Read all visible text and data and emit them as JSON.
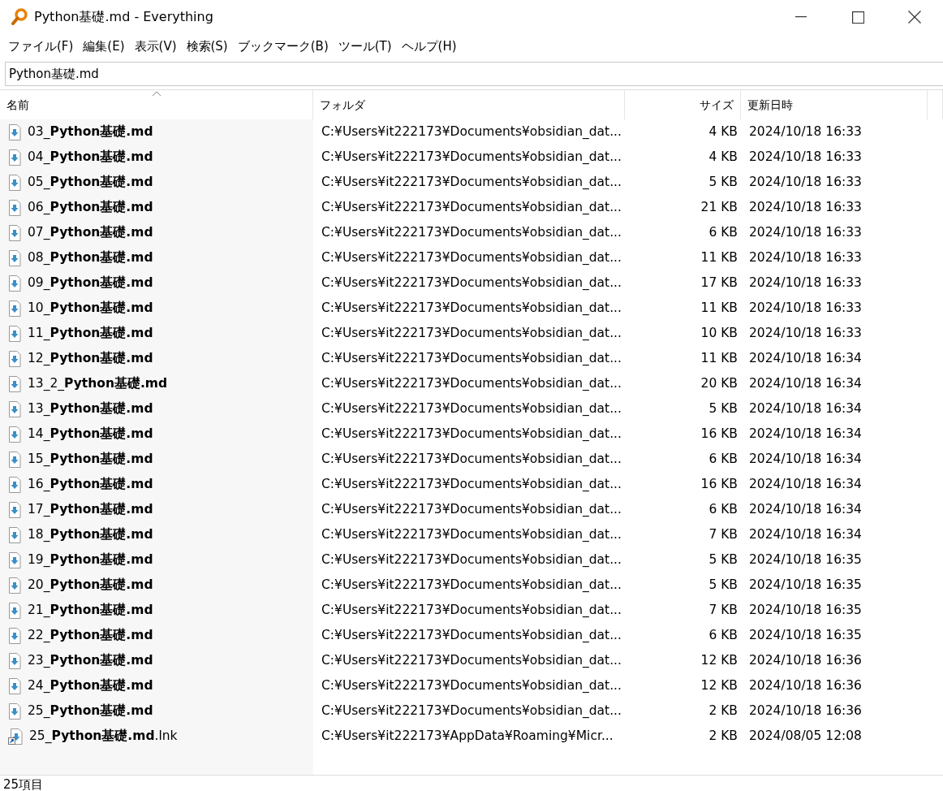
{
  "window": {
    "title": "Python基礎.md - Everything"
  },
  "menu": [
    "ファイル(F)",
    "編集(E)",
    "表示(V)",
    "検索(S)",
    "ブックマーク(B)",
    "ツール(T)",
    "ヘルプ(H)"
  ],
  "search": {
    "value": "Python基礎.md"
  },
  "columns": [
    {
      "label": "名前",
      "sorted": true
    },
    {
      "label": "フォルダ",
      "sorted": false
    },
    {
      "label": "サイズ",
      "sorted": false
    },
    {
      "label": "更新日時",
      "sorted": false
    }
  ],
  "rows": [
    {
      "kind": "file",
      "name": "03_**Python基礎.md**",
      "folder": "C:¥Users¥it222173¥Documents¥obsidian_dat...",
      "size": "4 KB",
      "modified": "2024/10/18 16:33"
    },
    {
      "kind": "file",
      "name": "04_**Python基礎.md**",
      "folder": "C:¥Users¥it222173¥Documents¥obsidian_dat...",
      "size": "4 KB",
      "modified": "2024/10/18 16:33"
    },
    {
      "kind": "file",
      "name": "05_**Python基礎.md**",
      "folder": "C:¥Users¥it222173¥Documents¥obsidian_dat...",
      "size": "5 KB",
      "modified": "2024/10/18 16:33"
    },
    {
      "kind": "file",
      "name": "06_**Python基礎.md**",
      "folder": "C:¥Users¥it222173¥Documents¥obsidian_dat...",
      "size": "21 KB",
      "modified": "2024/10/18 16:33"
    },
    {
      "kind": "file",
      "name": "07_**Python基礎.md**",
      "folder": "C:¥Users¥it222173¥Documents¥obsidian_dat...",
      "size": "6 KB",
      "modified": "2024/10/18 16:33"
    },
    {
      "kind": "file",
      "name": "08_**Python基礎.md**",
      "folder": "C:¥Users¥it222173¥Documents¥obsidian_dat...",
      "size": "11 KB",
      "modified": "2024/10/18 16:33"
    },
    {
      "kind": "file",
      "name": "09_**Python基礎.md**",
      "folder": "C:¥Users¥it222173¥Documents¥obsidian_dat...",
      "size": "17 KB",
      "modified": "2024/10/18 16:33"
    },
    {
      "kind": "file",
      "name": "10_**Python基礎.md**",
      "folder": "C:¥Users¥it222173¥Documents¥obsidian_dat...",
      "size": "11 KB",
      "modified": "2024/10/18 16:33"
    },
    {
      "kind": "file",
      "name": "11_**Python基礎.md**",
      "folder": "C:¥Users¥it222173¥Documents¥obsidian_dat...",
      "size": "10 KB",
      "modified": "2024/10/18 16:33"
    },
    {
      "kind": "file",
      "name": "12_**Python基礎.md**",
      "folder": "C:¥Users¥it222173¥Documents¥obsidian_dat...",
      "size": "11 KB",
      "modified": "2024/10/18 16:34"
    },
    {
      "kind": "file",
      "name": "13_2_**Python基礎.md**",
      "folder": "C:¥Users¥it222173¥Documents¥obsidian_dat...",
      "size": "20 KB",
      "modified": "2024/10/18 16:34"
    },
    {
      "kind": "file",
      "name": "13_**Python基礎.md**",
      "folder": "C:¥Users¥it222173¥Documents¥obsidian_dat...",
      "size": "5 KB",
      "modified": "2024/10/18 16:34"
    },
    {
      "kind": "file",
      "name": "14_**Python基礎.md**",
      "folder": "C:¥Users¥it222173¥Documents¥obsidian_dat...",
      "size": "16 KB",
      "modified": "2024/10/18 16:34"
    },
    {
      "kind": "file",
      "name": "15_**Python基礎.md**",
      "folder": "C:¥Users¥it222173¥Documents¥obsidian_dat...",
      "size": "6 KB",
      "modified": "2024/10/18 16:34"
    },
    {
      "kind": "file",
      "name": "16_**Python基礎.md**",
      "folder": "C:¥Users¥it222173¥Documents¥obsidian_dat...",
      "size": "16 KB",
      "modified": "2024/10/18 16:34"
    },
    {
      "kind": "file",
      "name": "17_**Python基礎.md**",
      "folder": "C:¥Users¥it222173¥Documents¥obsidian_dat...",
      "size": "6 KB",
      "modified": "2024/10/18 16:34"
    },
    {
      "kind": "file",
      "name": "18_**Python基礎.md**",
      "folder": "C:¥Users¥it222173¥Documents¥obsidian_dat...",
      "size": "7 KB",
      "modified": "2024/10/18 16:34"
    },
    {
      "kind": "file",
      "name": "19_**Python基礎.md**",
      "folder": "C:¥Users¥it222173¥Documents¥obsidian_dat...",
      "size": "5 KB",
      "modified": "2024/10/18 16:35"
    },
    {
      "kind": "file",
      "name": "20_**Python基礎.md**",
      "folder": "C:¥Users¥it222173¥Documents¥obsidian_dat...",
      "size": "5 KB",
      "modified": "2024/10/18 16:35"
    },
    {
      "kind": "file",
      "name": "21_**Python基礎.md**",
      "folder": "C:¥Users¥it222173¥Documents¥obsidian_dat...",
      "size": "7 KB",
      "modified": "2024/10/18 16:35"
    },
    {
      "kind": "file",
      "name": "22_**Python基礎.md**",
      "folder": "C:¥Users¥it222173¥Documents¥obsidian_dat...",
      "size": "6 KB",
      "modified": "2024/10/18 16:35"
    },
    {
      "kind": "file",
      "name": "23_**Python基礎.md**",
      "folder": "C:¥Users¥it222173¥Documents¥obsidian_dat...",
      "size": "12 KB",
      "modified": "2024/10/18 16:36"
    },
    {
      "kind": "file",
      "name": "24_**Python基礎.md**",
      "folder": "C:¥Users¥it222173¥Documents¥obsidian_dat...",
      "size": "12 KB",
      "modified": "2024/10/18 16:36"
    },
    {
      "kind": "file",
      "name": "25_**Python基礎.md**",
      "folder": "C:¥Users¥it222173¥Documents¥obsidian_dat...",
      "size": "2 KB",
      "modified": "2024/10/18 16:36"
    },
    {
      "kind": "shortcut",
      "name": "25_**Python基礎.md**.lnk",
      "folder": "C:¥Users¥it222173¥AppData¥Roaming¥Micr...",
      "size": "2 KB",
      "modified": "2024/08/05 12:08"
    }
  ],
  "status_bar": "25項目"
}
